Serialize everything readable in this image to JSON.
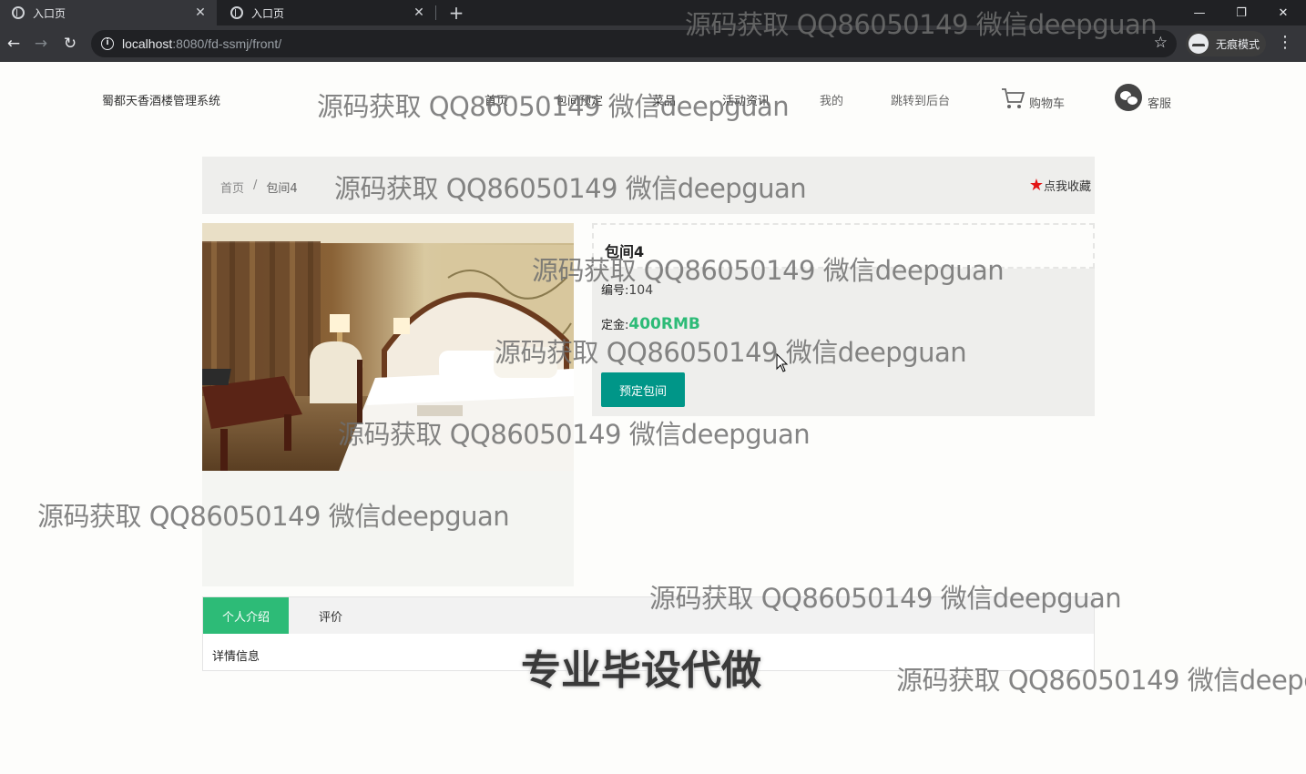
{
  "browser": {
    "tabs": [
      {
        "title": "入口页",
        "close": "✕"
      },
      {
        "title": "入口页",
        "close": "✕"
      }
    ],
    "new_tab": "+",
    "window_controls": {
      "minimize": "—",
      "restore": "❐",
      "close": "✕"
    },
    "url_host": "localhost",
    "url_path": ":8080/fd-ssmj/front/",
    "incognito_label": "无痕模式",
    "icons": [
      "back-arrow-icon",
      "forward-arrow-icon",
      "reload-icon",
      "info-icon",
      "star-icon",
      "incognito-icon",
      "menu-icon"
    ]
  },
  "site": {
    "brand": "蜀都天香酒楼管理系统",
    "nav": [
      "首页",
      "包间预定",
      "菜品",
      "活动资讯",
      "我的",
      "跳转到后台"
    ],
    "cart_label": "购物车",
    "service_label": "客服"
  },
  "breadcrumb": {
    "home": "首页",
    "separator": "/",
    "current": "包间4",
    "favorite": "点我收藏"
  },
  "product": {
    "title": "包间4",
    "code_label": "编号:",
    "code_value": "104",
    "deposit_label": "定金:",
    "deposit_value": "400RMB",
    "book_button": "预定包间"
  },
  "tabs": {
    "items": [
      "个人介绍",
      "评价"
    ],
    "content": "详情信息"
  },
  "watermarks": {
    "text": "源码获取 QQ86050149 微信deepguan",
    "big": "专业毕设代做"
  },
  "colors": {
    "accent_green": "#2dbb77",
    "teal_button": "#009688",
    "favorite_star": "#e31414"
  }
}
